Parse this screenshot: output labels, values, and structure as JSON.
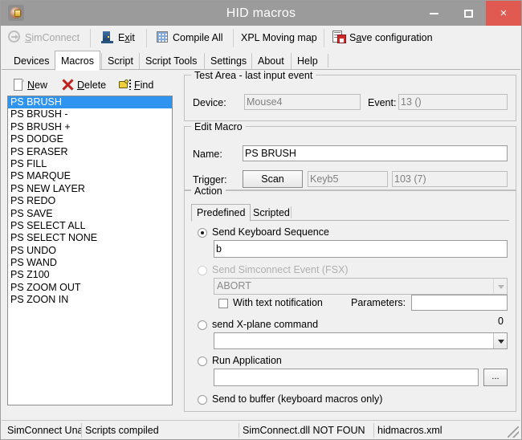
{
  "window": {
    "title": "HID macros",
    "icon": "app-icon",
    "controls": {
      "minimize": "minimize-button",
      "maximize": "maximize-button",
      "close": "×"
    }
  },
  "toolbar": {
    "items": [
      {
        "label": "SimConnect",
        "icon": "simconnect-icon",
        "disabled": true,
        "accel": "S"
      },
      {
        "label": "Exit",
        "icon": "exit-door-icon",
        "disabled": false,
        "accel": "x"
      },
      {
        "label": "Compile All",
        "icon": "compile-grid-icon",
        "disabled": false,
        "accel": ""
      },
      {
        "label": "XPL Moving map",
        "icon": "",
        "disabled": false,
        "accel": ""
      },
      {
        "label": "Save configuration",
        "icon": "save-disk-icon",
        "disabled": false,
        "accel": "a"
      }
    ]
  },
  "tabs": {
    "items": [
      "Devices",
      "Macros",
      "Script",
      "Script Tools",
      "Settings",
      "About",
      "Help"
    ],
    "active": "Macros"
  },
  "left_pane": {
    "actions": [
      {
        "label": "New",
        "icon": "new-page-icon",
        "accel": "N"
      },
      {
        "label": "Delete",
        "icon": "delete-x-icon",
        "accel": "D"
      },
      {
        "label": "Find",
        "icon": "find-hand-icon",
        "accel": "F"
      }
    ],
    "macro_list": {
      "selected": "PS BRUSH",
      "items": [
        "PS BRUSH",
        "PS BRUSH -",
        "PS BRUSH +",
        "PS DODGE",
        "PS ERASER",
        "PS FILL",
        "PS MARQUE",
        "PS NEW LAYER",
        "PS REDO",
        "PS SAVE",
        "PS SELECT ALL",
        "PS SELECT NONE",
        "PS UNDO",
        "PS WAND",
        "PS Z100",
        "PS ZOOM OUT",
        "PS ZOON IN"
      ]
    }
  },
  "test_area": {
    "title": "Test Area - last input event",
    "device_label": "Device:",
    "device_value": "Mouse4",
    "event_label": "Event:",
    "event_value": "13 ()"
  },
  "edit_macro": {
    "title": "Edit Macro",
    "name_label": "Name:",
    "name_value": "PS BRUSH",
    "trigger_label": "Trigger:",
    "scan_button": "Scan",
    "trigger_device": "Keyb5",
    "trigger_code": "103  (7)"
  },
  "action": {
    "title": "Action",
    "tabs": {
      "items": [
        "Predefined",
        "Scripted"
      ],
      "active": "Predefined"
    },
    "keyboard_sequence": {
      "label": "Send Keyboard Sequence",
      "selected": true,
      "value": "b"
    },
    "simconnect_event": {
      "label": "Send Simconnect Event (FSX)",
      "selected": false,
      "disabled": true,
      "combo_value": "ABORT",
      "checkbox_label": "With text notification",
      "checkbox_checked": false,
      "parameters_label": "Parameters:",
      "parameters_value": ""
    },
    "xplane_command": {
      "label": "send X-plane command",
      "selected": false,
      "combo_value": "",
      "counter": "0"
    },
    "run_application": {
      "label": "Run Application",
      "selected": false,
      "value": "",
      "browse_button": "..."
    },
    "send_to_buffer": {
      "label": "Send to buffer (keyboard macros only)",
      "selected": false
    }
  },
  "statusbar": {
    "cells": [
      "SimConnect Unav",
      "Scripts compiled",
      "SimConnect.dll NOT FOUN",
      "hidmacros.xml"
    ]
  },
  "colors": {
    "titlebar": "#9b9b9b",
    "close_button": "#e05a52",
    "selection": "#2f94f0",
    "window_bg": "#f0f0f0"
  }
}
